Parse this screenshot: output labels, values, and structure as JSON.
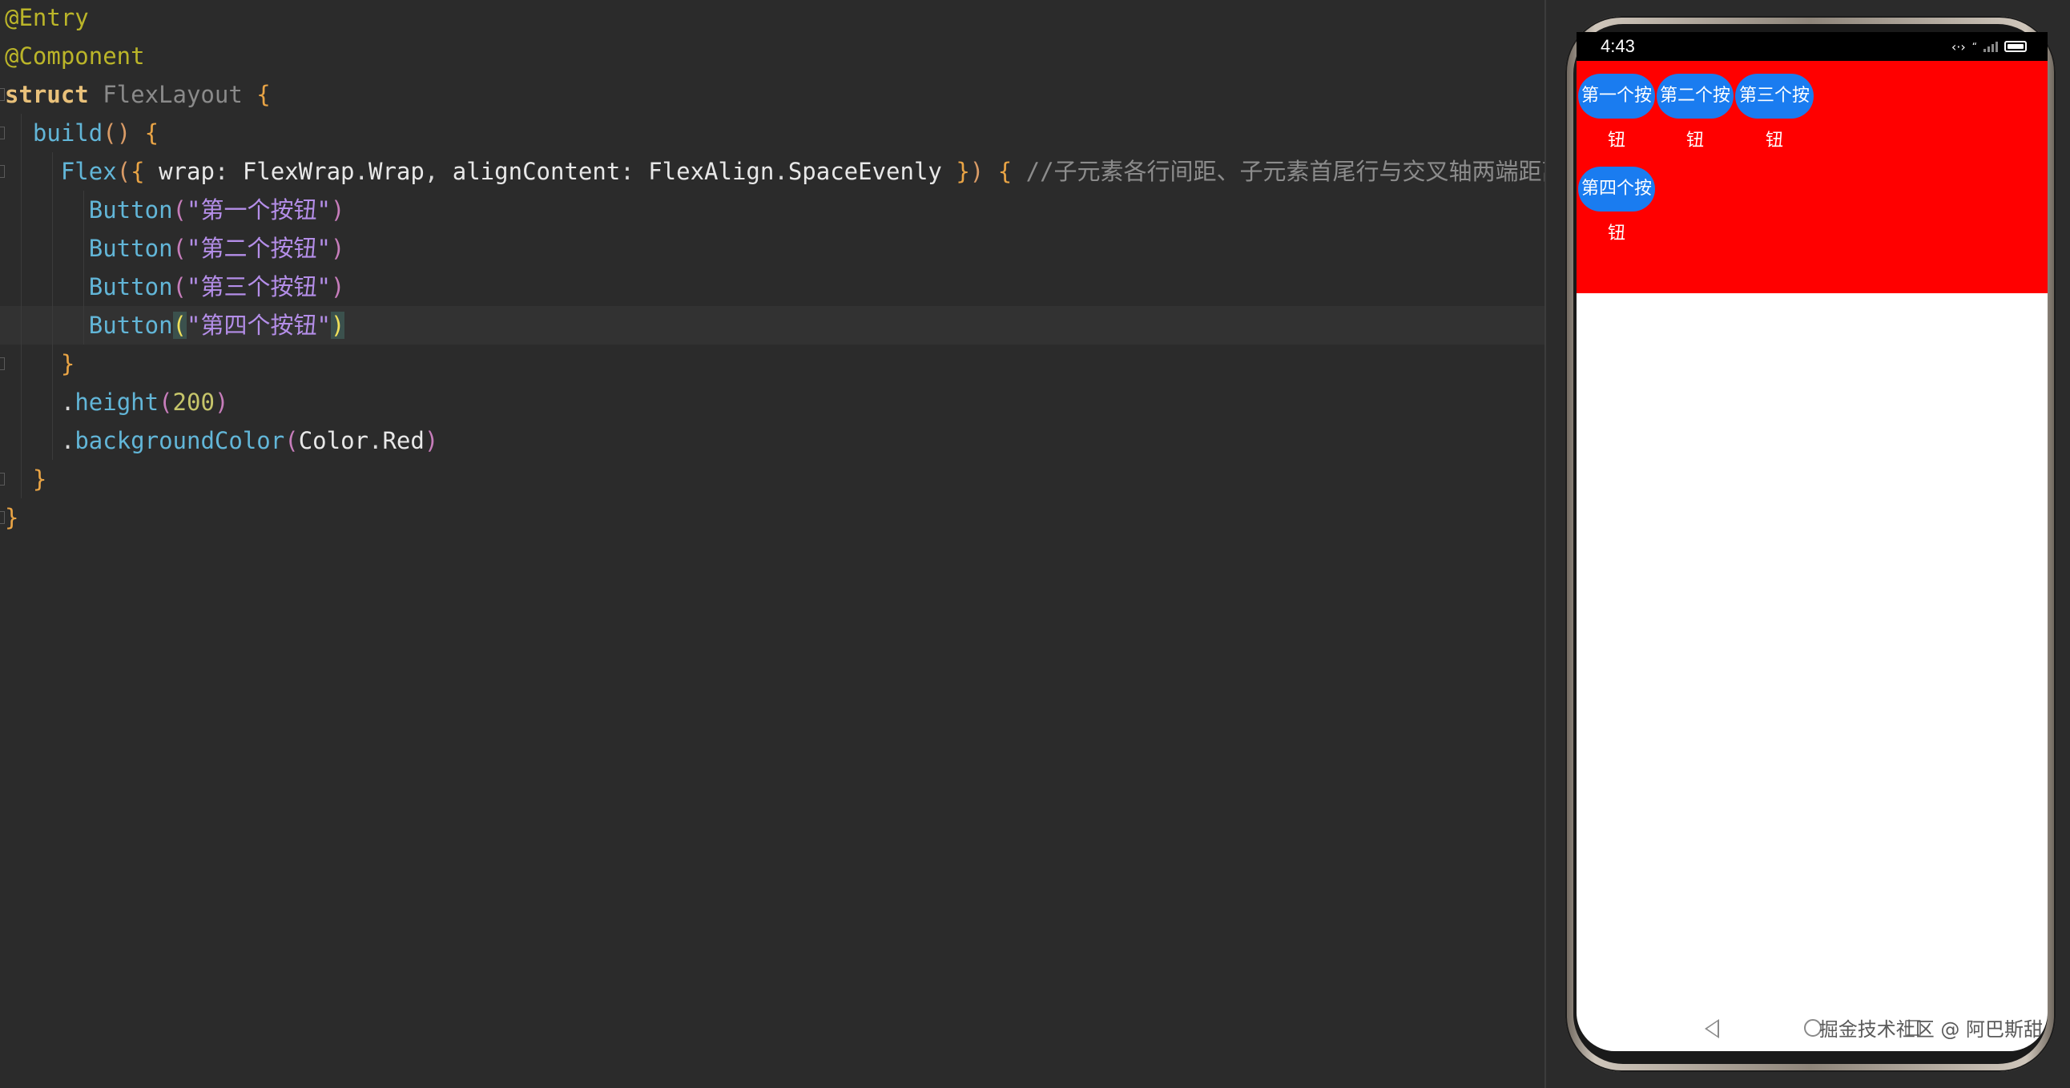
{
  "editor": {
    "lines": [
      {
        "tokens": [
          {
            "c": "t-ann",
            "t": "@Entry"
          }
        ]
      },
      {
        "tokens": [
          {
            "c": "t-ann",
            "t": "@Component"
          }
        ]
      },
      {
        "tokens": [
          {
            "c": "t-kw",
            "t": "struct "
          },
          {
            "c": "t-type",
            "t": "FlexLayout "
          },
          {
            "c": "t-brace",
            "t": "{"
          }
        ]
      },
      {
        "tokens": [
          {
            "c": "t-plain",
            "t": "  "
          },
          {
            "c": "t-fn",
            "t": "build"
          },
          {
            "c": "t-paren",
            "t": "() "
          },
          {
            "c": "t-brace",
            "t": "{"
          }
        ]
      },
      {
        "tokens": [
          {
            "c": "t-plain",
            "t": "    "
          },
          {
            "c": "t-fn",
            "t": "Flex"
          },
          {
            "c": "t-paren",
            "t": "("
          },
          {
            "c": "t-brace",
            "t": "{ "
          },
          {
            "c": "t-ident",
            "t": "wrap"
          },
          {
            "c": "t-plain",
            "t": ": "
          },
          {
            "c": "t-ident",
            "t": "FlexWrap"
          },
          {
            "c": "t-plain",
            "t": "."
          },
          {
            "c": "t-ident",
            "t": "Wrap"
          },
          {
            "c": "t-plain",
            "t": ", "
          },
          {
            "c": "t-ident",
            "t": "alignContent"
          },
          {
            "c": "t-plain",
            "t": ": "
          },
          {
            "c": "t-ident",
            "t": "FlexAlign"
          },
          {
            "c": "t-plain",
            "t": "."
          },
          {
            "c": "t-ident",
            "t": "SpaceEvenly "
          },
          {
            "c": "t-brace",
            "t": "}"
          },
          {
            "c": "t-paren",
            "t": ") "
          },
          {
            "c": "t-brace",
            "t": "{ "
          },
          {
            "c": "t-comment",
            "t": "//子元素各行间距、子元素首尾行与交叉轴两端距离都相等。"
          }
        ]
      },
      {
        "tokens": [
          {
            "c": "t-plain",
            "t": "      "
          },
          {
            "c": "t-fn",
            "t": "Button"
          },
          {
            "c": "t-paren2",
            "t": "("
          },
          {
            "c": "t-str",
            "t": "\"第一个按钮\""
          },
          {
            "c": "t-paren2",
            "t": ")"
          }
        ]
      },
      {
        "tokens": [
          {
            "c": "t-plain",
            "t": "      "
          },
          {
            "c": "t-fn",
            "t": "Button"
          },
          {
            "c": "t-paren2",
            "t": "("
          },
          {
            "c": "t-str",
            "t": "\"第二个按钮\""
          },
          {
            "c": "t-paren2",
            "t": ")"
          }
        ]
      },
      {
        "tokens": [
          {
            "c": "t-plain",
            "t": "      "
          },
          {
            "c": "t-fn",
            "t": "Button"
          },
          {
            "c": "t-paren2",
            "t": "("
          },
          {
            "c": "t-str",
            "t": "\"第三个按钮\""
          },
          {
            "c": "t-paren2",
            "t": ")"
          }
        ]
      },
      {
        "tokens": [
          {
            "c": "t-plain",
            "t": "      "
          },
          {
            "c": "t-fn",
            "t": "Button"
          },
          {
            "c": "t-match",
            "t": "("
          },
          {
            "c": "t-str",
            "t": "\"第四个按钮\""
          },
          {
            "c": "t-match",
            "t": ")"
          }
        ],
        "current": true
      },
      {
        "tokens": [
          {
            "c": "t-plain",
            "t": "    "
          },
          {
            "c": "t-brace",
            "t": "}"
          }
        ]
      },
      {
        "tokens": [
          {
            "c": "t-plain",
            "t": "    ."
          },
          {
            "c": "t-fn",
            "t": "height"
          },
          {
            "c": "t-paren2",
            "t": "("
          },
          {
            "c": "t-num",
            "t": "200"
          },
          {
            "c": "t-paren2",
            "t": ")"
          }
        ]
      },
      {
        "tokens": [
          {
            "c": "t-plain",
            "t": "    ."
          },
          {
            "c": "t-fn",
            "t": "backgroundColor"
          },
          {
            "c": "t-paren2",
            "t": "("
          },
          {
            "c": "t-ident",
            "t": "Color"
          },
          {
            "c": "t-plain",
            "t": "."
          },
          {
            "c": "t-ident",
            "t": "Red"
          },
          {
            "c": "t-paren2",
            "t": ")"
          }
        ]
      },
      {
        "tokens": [
          {
            "c": "t-plain",
            "t": "  "
          },
          {
            "c": "t-brace",
            "t": "}"
          }
        ]
      },
      {
        "tokens": [
          {
            "c": "t-brace",
            "t": "}"
          }
        ]
      }
    ]
  },
  "previewer": {
    "status_bar": {
      "time": "4:43",
      "icons": [
        "code-arrows-icon",
        "quote-icon",
        "signal-icon",
        "battery-icon"
      ]
    },
    "flex_container": {
      "background_color": "#ff0000"
    },
    "buttons": [
      {
        "label": "第一个按钮"
      },
      {
        "label": "第二个按钮"
      },
      {
        "label": "第三个按钮"
      },
      {
        "label": "第四个按钮"
      }
    ],
    "button_color": "#1a7cf0",
    "watermark": "掘金技术社区 @ 阿巴斯甜"
  }
}
